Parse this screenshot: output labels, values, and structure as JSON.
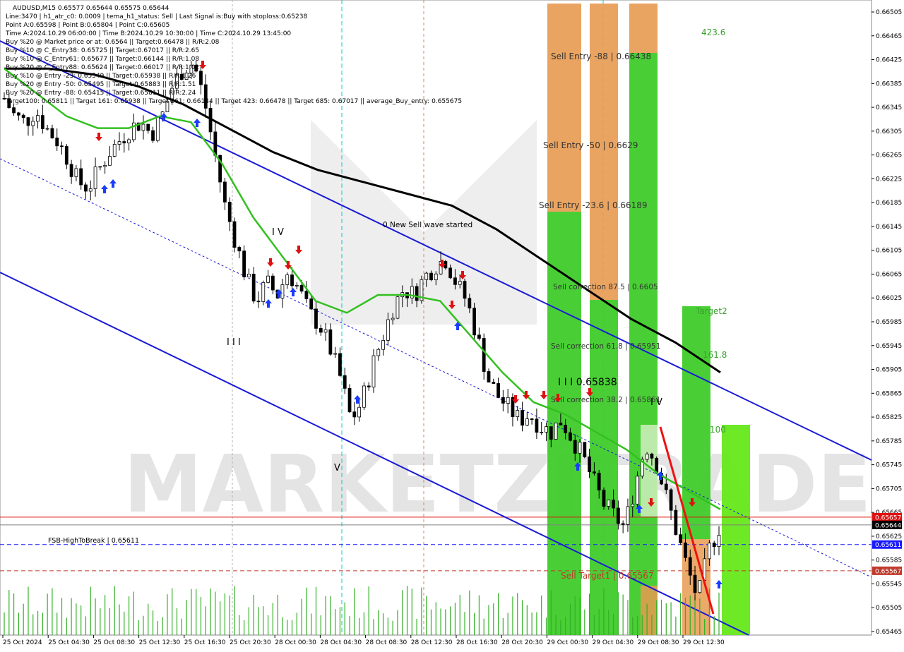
{
  "header": {
    "symbol_line": "AUDUSD,M15  0.65577 0.65644 0.65575 0.65644",
    "info_lines": [
      "Line:3470  |  h1_atr_c0: 0.0009  |  tema_h1_status: Sell  |  Last Signal is:Buy with stoploss:0.65238",
      "Point A:0.65598  |  Point B:0.65804  |  Point C:0.65605",
      "Time A:2024.10.29 06:00:00  |  Time B:2024.10.29 10:30:00  |  Time C:2024.10.29 13:45:00",
      "Buy %20 @ Market price or at: 0.6564  ||  Target:0.66478  ||  R/R:2.08",
      "Buy %10 @ C_Entry38: 0.65725  ||  Target:0.67017  ||  R/R:2.65",
      "Buy %10 @ C_Entry61: 0.65677  ||  Target:0.66144  ||  R/R:1.08",
      "Buy %20 @ C_Entry88: 0.65624  ||  Target:0.66017  ||  R/R:1.02",
      "Buy %10 @ Entry -23: 0.65549  ||  Target:0.65938  ||  R/R:1.26",
      "Buy %20 @ Entry -50: 0.65495  ||  Target:0.65883  ||  R/R:1.51",
      "Buy %20 @ Entry -88: 0.65415  ||  Target:0.65811  ||  R/R:2.24",
      "Target100: 0.65811  ||  Target 161: 0.65938  ||  Target 261: 0.66144  ||  Target 423: 0.66478  ||  Target 685: 0.67017  ||  average_Buy_entry: 0.655675"
    ]
  },
  "watermark": {
    "text_left": "MARKETZI",
    "text_right": "TRADE"
  },
  "axis": {
    "y_ticks": [
      "0.66505",
      "0.66465",
      "0.66425",
      "0.66385",
      "0.66345",
      "0.66305",
      "0.66265",
      "0.66225",
      "0.66185",
      "0.66145",
      "0.66105",
      "0.66065",
      "0.66025",
      "0.65985",
      "0.65945",
      "0.65905",
      "0.65865",
      "0.65825",
      "0.65785",
      "0.65745",
      "0.65705",
      "0.65665",
      "0.65625",
      "0.65585",
      "0.65545",
      "0.65505",
      "0.65465"
    ],
    "x_ticks": [
      "25 Oct 2024",
      "25 Oct 04:30",
      "25 Oct 08:30",
      "25 Oct 12:30",
      "25 Oct 16:30",
      "25 Oct 20:30",
      "28 Oct 00:30",
      "28 Oct 04:30",
      "28 Oct 08:30",
      "28 Oct 12:30",
      "28 Oct 16:30",
      "28 Oct 20:30",
      "29 Oct 00:30",
      "29 Oct 04:30",
      "29 Oct 08:30",
      "29 Oct 12:30"
    ],
    "price_tags": [
      {
        "value": "0.65657",
        "color": "#e01010"
      },
      {
        "value": "0.65644",
        "color": "#000000"
      },
      {
        "value": "0.65611",
        "color": "#1a1aff"
      },
      {
        "value": "0.65567",
        "color": "#c0392b"
      }
    ]
  },
  "labels": {
    "new_sell_wave": "0 New Sell wave started",
    "fsb": "FSB-HighToBreak | 0.65611",
    "level_65838": "I I I 0.65838",
    "roman_iv_top": "I V",
    "roman_iii": "I I I",
    "roman_v": "V",
    "roman_iv_right": "I V"
  },
  "zones": {
    "sell_entry_88": "Sell Entry -88 | 0.66438",
    "sell_entry_50": "Sell Entry -50 | 0.6629",
    "sell_entry_236": "Sell Entry -23.6 | 0.66189",
    "sell_corr_875": "Sell correction 87.5 | 0.6605",
    "sell_corr_618": "Sell correction 61.8 | 0.65951",
    "sell_corr_382": "Sell correction 38.2 | 0.65861",
    "sell_target1": "Sell Target1 | 0.65567",
    "t423": "423.6",
    "target2": "Target2",
    "t1618": "161.8",
    "t100": "100"
  },
  "chart_data": {
    "type": "candlestick",
    "symbol": "AUDUSD",
    "timeframe": "M15",
    "last_ohlc": {
      "open": 0.65577,
      "high": 0.65644,
      "low": 0.65575,
      "close": 0.65644
    },
    "ylim": [
      0.65465,
      0.66505
    ],
    "horizontal_levels": [
      {
        "value": 0.65657,
        "style": "solid",
        "color": "#e01010"
      },
      {
        "value": 0.65644,
        "style": "solid",
        "color": "#808080"
      },
      {
        "value": 0.65611,
        "style": "dashed",
        "color": "#1a1aff"
      },
      {
        "value": 0.65567,
        "style": "dashed",
        "color": "#c0392b"
      }
    ],
    "close_path": [
      0.6636,
      0.6633,
      0.6632,
      0.6634,
      0.6631,
      0.6629,
      0.6626,
      0.6622,
      0.6621,
      0.6624,
      0.6627,
      0.6629,
      0.6631,
      0.6632,
      0.663,
      0.6633,
      0.6638,
      0.6641,
      0.6642,
      0.6636,
      0.6627,
      0.6618,
      0.6612,
      0.6606,
      0.6602,
      0.6605,
      0.6603,
      0.6607,
      0.6604,
      0.66,
      0.6598,
      0.6594,
      0.6589,
      0.6582,
      0.6585,
      0.6591,
      0.6596,
      0.6601,
      0.6604,
      0.6603,
      0.6606,
      0.6608,
      0.6609,
      0.6605,
      0.6602,
      0.6596,
      0.6589,
      0.6586,
      0.6584,
      0.6582,
      0.6583,
      0.6581,
      0.658,
      0.6582,
      0.6579,
      0.6576,
      0.6572,
      0.6568,
      0.6566,
      0.6564,
      0.6571,
      0.6578,
      0.6575,
      0.6569,
      0.6563,
      0.6557,
      0.6552,
      0.656,
      0.6564
    ],
    "ema_green": [
      0.6641,
      0.6637,
      0.6633,
      0.6631,
      0.6631,
      0.6633,
      0.6632,
      0.6625,
      0.6616,
      0.6609,
      0.6602,
      0.66,
      0.6603,
      0.6603,
      0.6602,
      0.6596,
      0.659,
      0.6585,
      0.6583,
      0.658,
      0.6577,
      0.6573,
      0.657,
      0.6567
    ],
    "ema_black": [
      0.6641,
      0.6641,
      0.664,
      0.6638,
      0.6635,
      0.6631,
      0.6627,
      0.6624,
      0.6622,
      0.662,
      0.6618,
      0.6614,
      0.6609,
      0.6604,
      0.6599,
      0.6595,
      0.659
    ]
  }
}
